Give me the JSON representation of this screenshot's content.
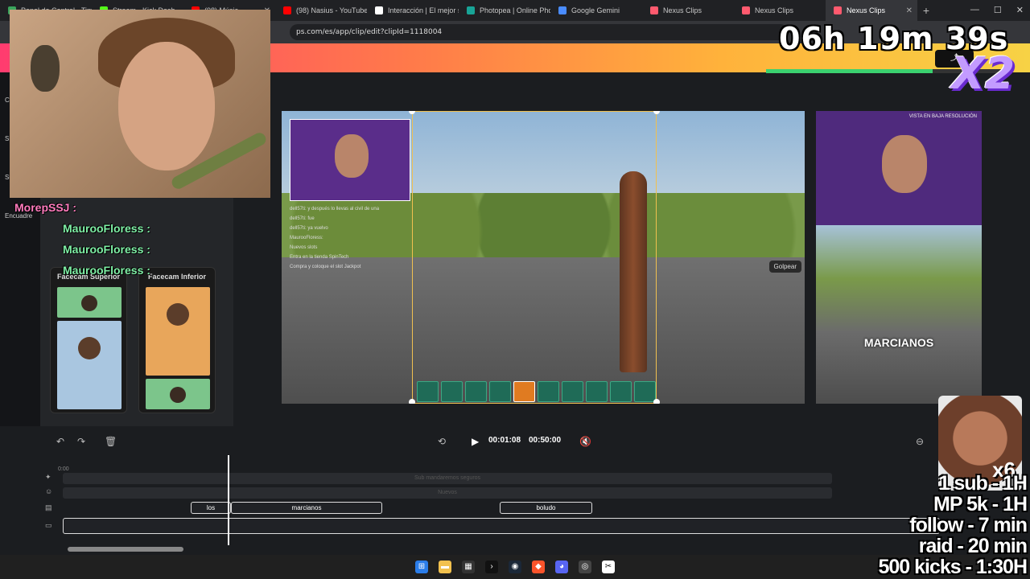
{
  "browser": {
    "tabs": [
      {
        "label": "Panel de Control - Tim",
        "color": "#3aa55c"
      },
      {
        "label": "Stream - Kick Dash",
        "color": "#53fc18"
      },
      {
        "label": "(98)  Músic",
        "color": "#ff0000"
      },
      {
        "label": "(98) Nasius - YouTube",
        "color": "#ff0000"
      },
      {
        "label": "Interacción | El mejor s",
        "color": "#ffffff"
      },
      {
        "label": "Photopea | Online Pho",
        "color": "#18a497"
      },
      {
        "label": "Google Gemini",
        "color": "#4a8cff"
      },
      {
        "label": "Nexus Clips",
        "color": "#ff5a6e"
      },
      {
        "label": "Nexus Clips",
        "color": "#ff5a6e"
      },
      {
        "label": "Nexus Clips",
        "color": "#ff5a6e"
      }
    ],
    "url": "ps.com/es/app/clip/edit?clipId=1118004"
  },
  "editor": {
    "left_labels": [
      "C",
      "S",
      "Su",
      "Encuadre"
    ],
    "layouts": [
      {
        "title": "Facecam Superior"
      },
      {
        "title": "Facecam Inferior"
      }
    ],
    "canvas": {
      "golpear": "Golpear",
      "chat": [
        "dell57ti: y después lo llevas al civil de una",
        "dell57ti: fue",
        "dell57ti: ya vuelvo",
        "MaurooFloress:",
        "Nuevos slots",
        "Entra en la tienda SpinTech",
        "Compra y coloque el slot Jackpot"
      ]
    },
    "preview": {
      "lowres": "VISTA EN BAJA RESOLUCIÓN",
      "caption": "MARCIANOS"
    },
    "controls": {
      "current_time": "00:01:08",
      "total_time": "00:50:00"
    },
    "timeline": {
      "start_tick": "0:00",
      "track1_placeholder": "Sub mandaremos seguros",
      "track2_placeholder": "Nuevos",
      "segments": [
        "los",
        "marcianos",
        "boludo"
      ]
    }
  },
  "overlay": {
    "timer": "06h 19m 39s",
    "timer_progress": 0.69,
    "multiplier": "X2",
    "meme_multiplier": "x6",
    "chat_names": [
      "MorepSSJ :",
      "MaurooFloress :",
      "MaurooFloress :",
      "MaurooFloress :"
    ],
    "goals": [
      "1 sub - 1H",
      "MP 5k - 1H",
      "follow - 7 min",
      "raid - 20 min",
      "500 kicks - 1:30H"
    ]
  }
}
